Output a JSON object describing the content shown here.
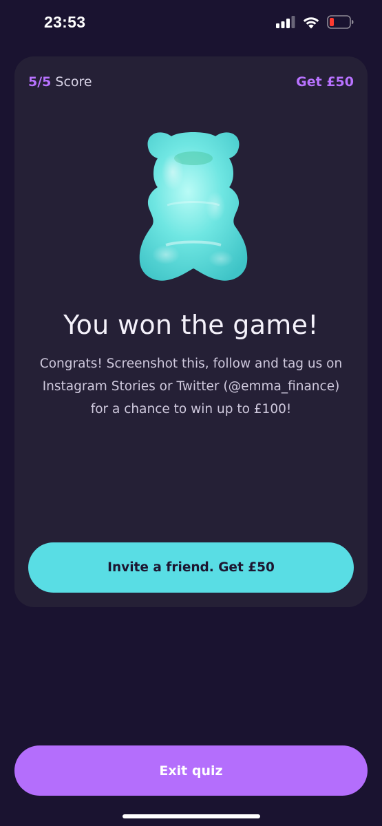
{
  "status_bar": {
    "time": "23:53",
    "icons": [
      "signal-icon",
      "wifi-icon",
      "battery-low-icon"
    ]
  },
  "card": {
    "score_value": "5/5",
    "score_label": "Score",
    "get_reward_label": "Get £50",
    "illustration": "gummy-bear-icon",
    "headline": "You won the game!",
    "body": "Congrats! Screenshot this, follow and tag us on Instagram Stories or Twitter (@emma_finance) for a chance to win up to £100!",
    "invite_button_label": "Invite a friend. Get £50"
  },
  "footer": {
    "exit_button_label": "Exit quiz"
  },
  "colors": {
    "background": "#1a1330",
    "card": "#252036",
    "accent_purple": "#b872ff",
    "accent_cyan": "#59dde4",
    "battery_low": "#ff3b30"
  }
}
